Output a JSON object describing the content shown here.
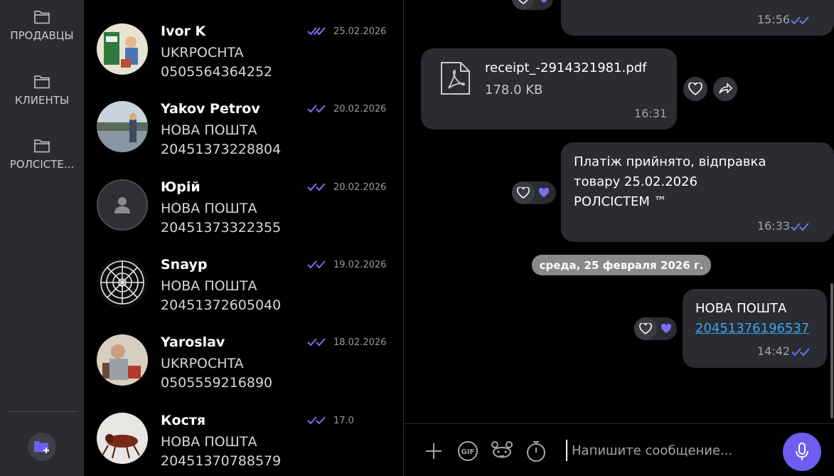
{
  "colors": {
    "accent": "#6d5df0",
    "tick": "#7b6ef5",
    "bubble": "#2a2c31",
    "link": "#3ba3f6",
    "rail": "#2a2b2e"
  },
  "folders": [
    {
      "label": "ПРОДАВЦЫ",
      "icon": "folder-icon"
    },
    {
      "label": "КЛИЕНТЫ",
      "icon": "folder-icon"
    },
    {
      "label": "РОЛСІСТЕ...",
      "icon": "folder-icon"
    }
  ],
  "chats": [
    {
      "name": "Ivor K",
      "line1": "UKRPOCHTA",
      "line2": "0505564364252",
      "date": "25.02.2026",
      "avatar": "stamp-photo"
    },
    {
      "name": "Yakov Petrov",
      "line1": "НОВА ПОШТА",
      "line2": "20451373228804",
      "date": "20.02.2026",
      "avatar": "lake-photo"
    },
    {
      "name": "Юрій",
      "line1": "НОВА ПОШТА",
      "line2": "20451373322355",
      "date": "20.02.2026",
      "avatar": "default-user"
    },
    {
      "name": "Snayp",
      "line1": "НОВА ПОШТА",
      "line2": "20451372605040",
      "date": "19.02.2026",
      "avatar": "mandala-photo"
    },
    {
      "name": "Yaroslav",
      "line1": "UKRPOCHTA",
      "line2": "0505559216890",
      "date": "18.02.2026",
      "avatar": "man-photo"
    },
    {
      "name": "Костя",
      "line1": "НОВА ПОШТА",
      "line2": "20451370788579",
      "date": "17.0",
      "avatar": "insect-photo"
    }
  ],
  "messages": {
    "top": {
      "time": "15:56"
    },
    "file": {
      "name": "receipt_-2914321981.pdf",
      "size": "178.0 KB",
      "time": "16:31",
      "icon": "pdf-icon"
    },
    "payment": {
      "line1": "Платіж прийнято, відправка",
      "line2": "товару 25.02.2026",
      "line3": "РОЛСІСТЕМ ™",
      "time": "16:33"
    },
    "date_separator": "среда, 25 февраля 2026 г.",
    "last": {
      "line1": "НОВА ПОШТА",
      "link": "20451376196537",
      "time": "14:42"
    }
  },
  "composer": {
    "placeholder": "Напишите сообщение...",
    "tools": [
      "plus-icon",
      "gif-icon",
      "sticker-icon",
      "timer-icon"
    ],
    "gif_label": "GIF"
  }
}
